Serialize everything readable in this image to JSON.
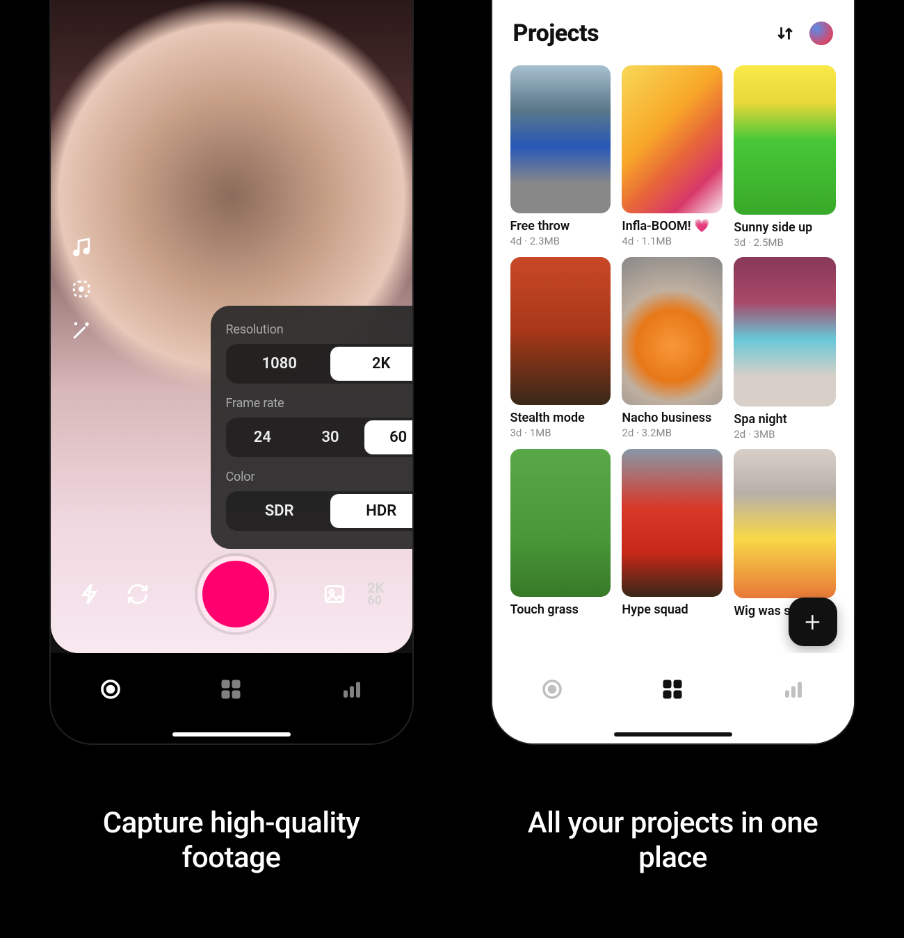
{
  "captions": {
    "left": "Capture high-quality footage",
    "right": "All your projects in one place"
  },
  "left_phone": {
    "settings": {
      "resolution": {
        "label": "Resolution",
        "options": [
          "1080",
          "2K"
        ],
        "selected": "2K"
      },
      "frame_rate": {
        "label": "Frame rate",
        "options": [
          "24",
          "30",
          "60"
        ],
        "selected": "60"
      },
      "color": {
        "label": "Color",
        "options": [
          "SDR",
          "HDR"
        ],
        "selected": "HDR"
      }
    },
    "side_icons": [
      "music-icon",
      "face-tracking-icon",
      "magic-wand-icon"
    ],
    "bottom_icons": {
      "flash": "flash-icon",
      "flip": "flip-camera-icon",
      "gallery": "gallery-icon"
    },
    "quality_badge": {
      "top": "2K",
      "bottom": "60"
    },
    "nav": {
      "items": [
        "record",
        "projects",
        "stats"
      ],
      "active": "record"
    }
  },
  "right_phone": {
    "header": {
      "title": "Projects",
      "sort_icon": "sort-icon",
      "avatar": "avatar"
    },
    "projects": [
      {
        "title": "Free throw",
        "meta": "4d · 2.3MB"
      },
      {
        "title": "Infla-BOOM! 💗",
        "meta": "4d · 1.1MB"
      },
      {
        "title": "Sunny side up",
        "meta": "3d · 2.5MB"
      },
      {
        "title": "Stealth mode",
        "meta": "3d · 1MB"
      },
      {
        "title": "Nacho business",
        "meta": "2d · 3.2MB"
      },
      {
        "title": "Spa night",
        "meta": "2d · 3MB"
      },
      {
        "title": "Touch grass",
        "meta": "",
        "hide_meta": true
      },
      {
        "title": "Hype squad",
        "meta": "",
        "hide_meta": true
      },
      {
        "title": "Wig was snatched",
        "meta": "",
        "hide_meta": true
      }
    ],
    "fab_label": "+",
    "nav": {
      "items": [
        "record",
        "projects",
        "stats"
      ],
      "active": "projects"
    }
  }
}
